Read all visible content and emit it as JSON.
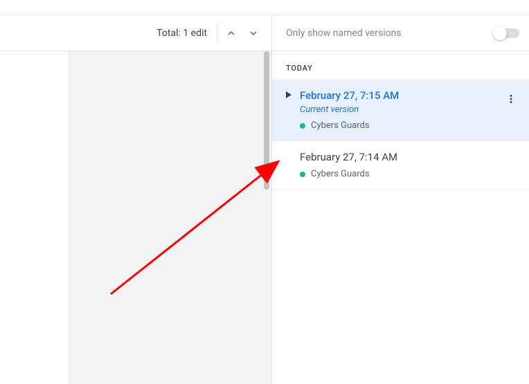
{
  "left": {
    "total_label": "Total: 1 edit"
  },
  "right": {
    "filter_label": "Only show named versions",
    "section_label": "TODAY",
    "versions": [
      {
        "time": "February 27, 7:15 AM",
        "subtitle": "Current version",
        "author": "Cybers Guards"
      },
      {
        "time": "February 27, 7:14 AM",
        "author": "Cybers Guards"
      }
    ]
  }
}
